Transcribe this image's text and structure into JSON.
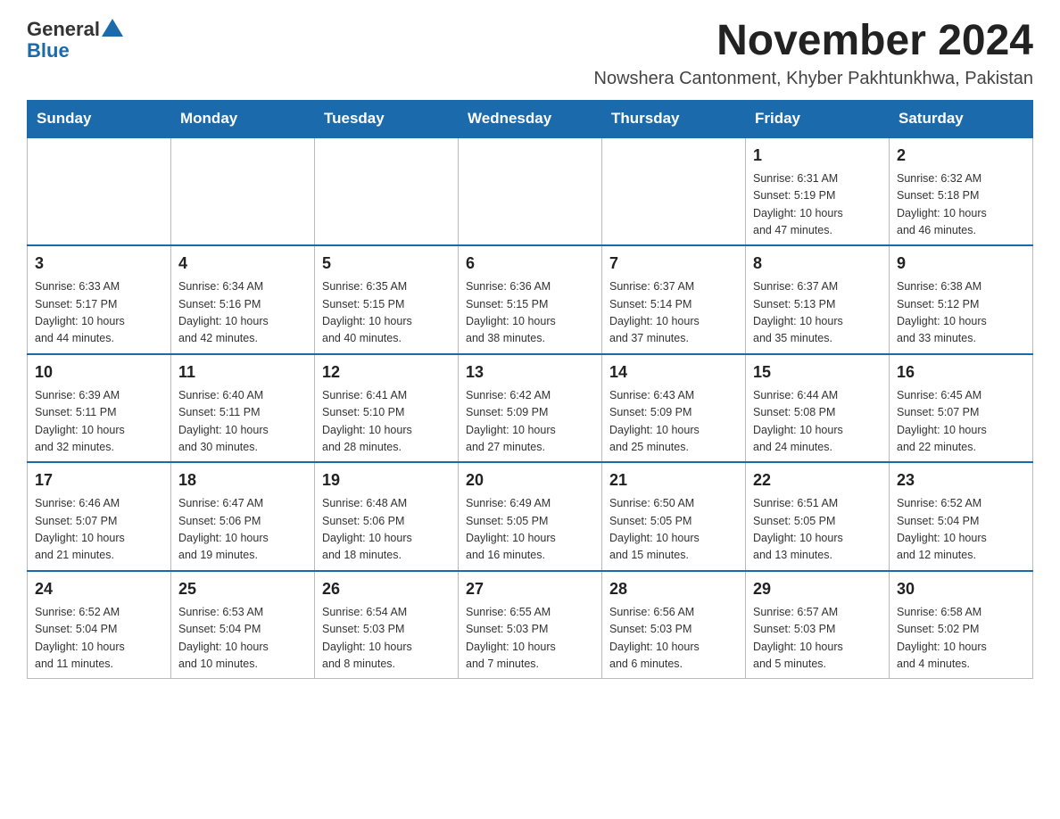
{
  "logo": {
    "text_general": "General",
    "text_blue": "Blue"
  },
  "title": "November 2024",
  "subtitle": "Nowshera Cantonment, Khyber Pakhtunkhwa, Pakistan",
  "weekdays": [
    "Sunday",
    "Monday",
    "Tuesday",
    "Wednesday",
    "Thursday",
    "Friday",
    "Saturday"
  ],
  "weeks": [
    [
      {
        "day": "",
        "info": ""
      },
      {
        "day": "",
        "info": ""
      },
      {
        "day": "",
        "info": ""
      },
      {
        "day": "",
        "info": ""
      },
      {
        "day": "",
        "info": ""
      },
      {
        "day": "1",
        "info": "Sunrise: 6:31 AM\nSunset: 5:19 PM\nDaylight: 10 hours\nand 47 minutes."
      },
      {
        "day": "2",
        "info": "Sunrise: 6:32 AM\nSunset: 5:18 PM\nDaylight: 10 hours\nand 46 minutes."
      }
    ],
    [
      {
        "day": "3",
        "info": "Sunrise: 6:33 AM\nSunset: 5:17 PM\nDaylight: 10 hours\nand 44 minutes."
      },
      {
        "day": "4",
        "info": "Sunrise: 6:34 AM\nSunset: 5:16 PM\nDaylight: 10 hours\nand 42 minutes."
      },
      {
        "day": "5",
        "info": "Sunrise: 6:35 AM\nSunset: 5:15 PM\nDaylight: 10 hours\nand 40 minutes."
      },
      {
        "day": "6",
        "info": "Sunrise: 6:36 AM\nSunset: 5:15 PM\nDaylight: 10 hours\nand 38 minutes."
      },
      {
        "day": "7",
        "info": "Sunrise: 6:37 AM\nSunset: 5:14 PM\nDaylight: 10 hours\nand 37 minutes."
      },
      {
        "day": "8",
        "info": "Sunrise: 6:37 AM\nSunset: 5:13 PM\nDaylight: 10 hours\nand 35 minutes."
      },
      {
        "day": "9",
        "info": "Sunrise: 6:38 AM\nSunset: 5:12 PM\nDaylight: 10 hours\nand 33 minutes."
      }
    ],
    [
      {
        "day": "10",
        "info": "Sunrise: 6:39 AM\nSunset: 5:11 PM\nDaylight: 10 hours\nand 32 minutes."
      },
      {
        "day": "11",
        "info": "Sunrise: 6:40 AM\nSunset: 5:11 PM\nDaylight: 10 hours\nand 30 minutes."
      },
      {
        "day": "12",
        "info": "Sunrise: 6:41 AM\nSunset: 5:10 PM\nDaylight: 10 hours\nand 28 minutes."
      },
      {
        "day": "13",
        "info": "Sunrise: 6:42 AM\nSunset: 5:09 PM\nDaylight: 10 hours\nand 27 minutes."
      },
      {
        "day": "14",
        "info": "Sunrise: 6:43 AM\nSunset: 5:09 PM\nDaylight: 10 hours\nand 25 minutes."
      },
      {
        "day": "15",
        "info": "Sunrise: 6:44 AM\nSunset: 5:08 PM\nDaylight: 10 hours\nand 24 minutes."
      },
      {
        "day": "16",
        "info": "Sunrise: 6:45 AM\nSunset: 5:07 PM\nDaylight: 10 hours\nand 22 minutes."
      }
    ],
    [
      {
        "day": "17",
        "info": "Sunrise: 6:46 AM\nSunset: 5:07 PM\nDaylight: 10 hours\nand 21 minutes."
      },
      {
        "day": "18",
        "info": "Sunrise: 6:47 AM\nSunset: 5:06 PM\nDaylight: 10 hours\nand 19 minutes."
      },
      {
        "day": "19",
        "info": "Sunrise: 6:48 AM\nSunset: 5:06 PM\nDaylight: 10 hours\nand 18 minutes."
      },
      {
        "day": "20",
        "info": "Sunrise: 6:49 AM\nSunset: 5:05 PM\nDaylight: 10 hours\nand 16 minutes."
      },
      {
        "day": "21",
        "info": "Sunrise: 6:50 AM\nSunset: 5:05 PM\nDaylight: 10 hours\nand 15 minutes."
      },
      {
        "day": "22",
        "info": "Sunrise: 6:51 AM\nSunset: 5:05 PM\nDaylight: 10 hours\nand 13 minutes."
      },
      {
        "day": "23",
        "info": "Sunrise: 6:52 AM\nSunset: 5:04 PM\nDaylight: 10 hours\nand 12 minutes."
      }
    ],
    [
      {
        "day": "24",
        "info": "Sunrise: 6:52 AM\nSunset: 5:04 PM\nDaylight: 10 hours\nand 11 minutes."
      },
      {
        "day": "25",
        "info": "Sunrise: 6:53 AM\nSunset: 5:04 PM\nDaylight: 10 hours\nand 10 minutes."
      },
      {
        "day": "26",
        "info": "Sunrise: 6:54 AM\nSunset: 5:03 PM\nDaylight: 10 hours\nand 8 minutes."
      },
      {
        "day": "27",
        "info": "Sunrise: 6:55 AM\nSunset: 5:03 PM\nDaylight: 10 hours\nand 7 minutes."
      },
      {
        "day": "28",
        "info": "Sunrise: 6:56 AM\nSunset: 5:03 PM\nDaylight: 10 hours\nand 6 minutes."
      },
      {
        "day": "29",
        "info": "Sunrise: 6:57 AM\nSunset: 5:03 PM\nDaylight: 10 hours\nand 5 minutes."
      },
      {
        "day": "30",
        "info": "Sunrise: 6:58 AM\nSunset: 5:02 PM\nDaylight: 10 hours\nand 4 minutes."
      }
    ]
  ]
}
